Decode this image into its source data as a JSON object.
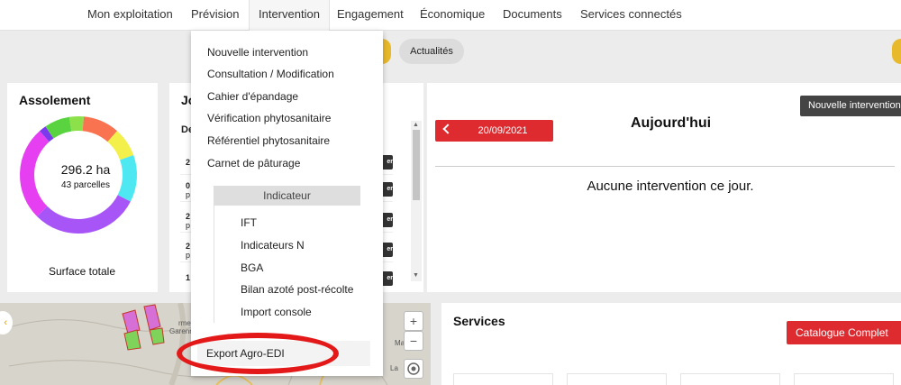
{
  "nav": {
    "items": [
      "Mon exploitation",
      "Prévision",
      "Intervention",
      "Engagement",
      "Économique",
      "Documents",
      "Services connectés"
    ],
    "active": "Intervention"
  },
  "subbar": {
    "actualites_label": "Actualités"
  },
  "assolement": {
    "title": "Assolement",
    "total_value": "296.2 ha",
    "parcels": "43 parcelles",
    "footer": "Surface totale",
    "segments": [
      {
        "color": "#a855f7",
        "share": 0.3
      },
      {
        "color": "#e63ff2",
        "share": 0.26
      },
      {
        "color": "#7c3aed",
        "share": 0.02
      },
      {
        "color": "#59d33f",
        "share": 0.07
      },
      {
        "color": "#8ce04a",
        "share": 0.04
      },
      {
        "color": "#f97350",
        "share": 0.1
      },
      {
        "color": "#f3f04b",
        "share": 0.08
      },
      {
        "color": "#4de8f1",
        "share": 0.13
      }
    ]
  },
  "journal": {
    "title_fragment": "Jo",
    "header_fragment": "De",
    "rows": [
      {
        "line1": "2",
        "line2": ""
      },
      {
        "line1": "0",
        "line2": "p"
      },
      {
        "line1": "2",
        "line2": "p"
      },
      {
        "line1": "2",
        "line2": "p"
      },
      {
        "line1": "1",
        "line2": ""
      }
    ],
    "row_button_fragment": "er"
  },
  "today": {
    "date": "20/09/2021",
    "title": "Aujourd'hui",
    "empty_message": "Aucune intervention ce jour.",
    "new_button": "Nouvelle intervention"
  },
  "services": {
    "title": "Services",
    "catalogue_button": "Catalogue Complet"
  },
  "map": {
    "labels": [
      "rme de",
      "Garenne",
      "Marque",
      "La"
    ],
    "zoom_in": "+",
    "zoom_out": "−",
    "back": "‹"
  },
  "dropdown": {
    "items": [
      "Nouvelle intervention",
      "Consultation / Modification",
      "Cahier d'épandage",
      "Vérification phytosanitaire",
      "Référentiel phytosanitaire",
      "Carnet de pâturage"
    ],
    "indicateur_header": "Indicateur",
    "indicateur_items": [
      "IFT",
      "Indicateurs N",
      "BGA",
      "Bilan azoté post-récolte",
      "Import console"
    ],
    "export_item": "Export Agro-EDI"
  },
  "colors": {
    "accent_red": "#dd2b30",
    "highlight_red": "#e31818",
    "yellow": "#e8b92b"
  }
}
